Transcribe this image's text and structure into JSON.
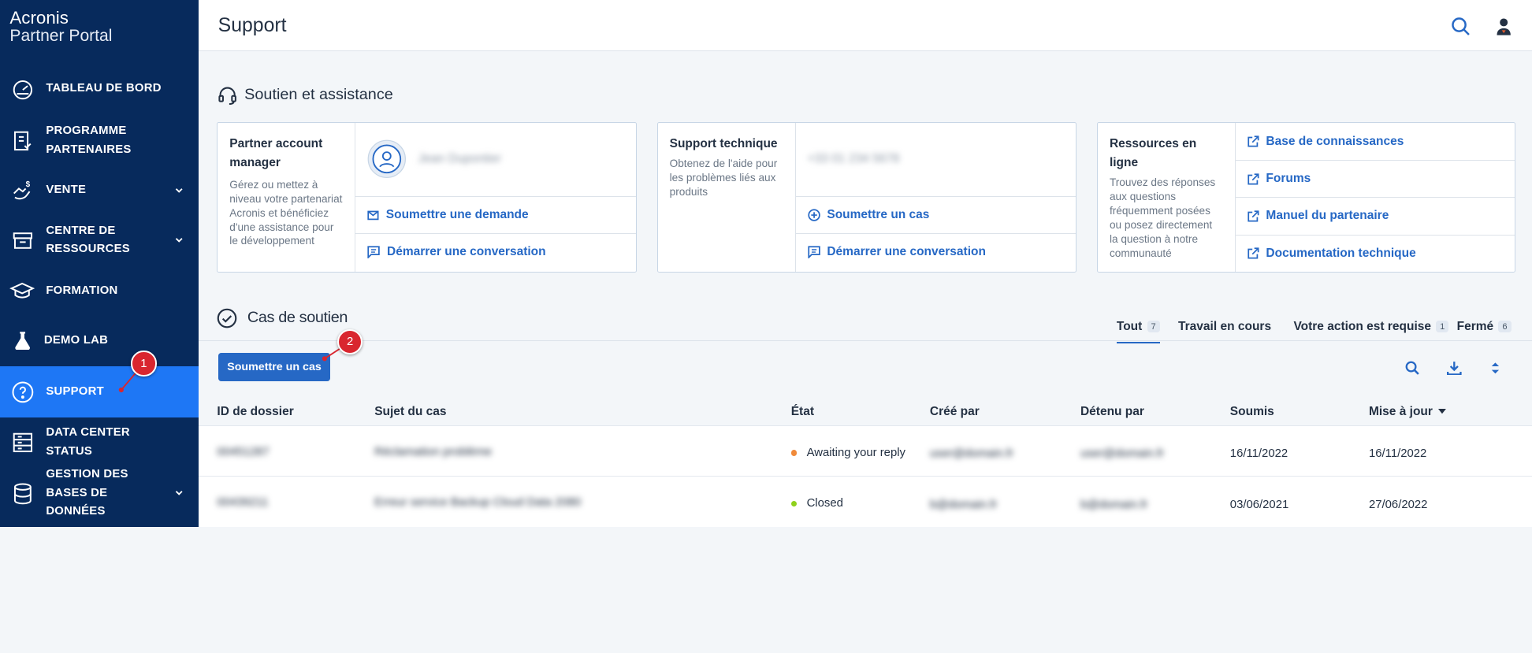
{
  "app": {
    "logo_line1": "Acronis",
    "logo_line2": "Partner Portal"
  },
  "sidebar": {
    "items": [
      {
        "label": "TABLEAU DE BORD"
      },
      {
        "label": "PROGRAMME PARTENAIRES"
      },
      {
        "label": "VENTE"
      },
      {
        "label": "CENTRE DE RESSOURCES"
      },
      {
        "label": "FORMATION"
      },
      {
        "label": "DEMO LAB"
      },
      {
        "label": "SUPPORT"
      },
      {
        "label": "DATA CENTER STATUS"
      },
      {
        "label": "GESTION DES BASES DE DONNÉES"
      }
    ]
  },
  "header": {
    "title": "Support"
  },
  "assist": {
    "heading": "Soutien et assistance",
    "card1": {
      "title": "Partner account manager",
      "desc": "Gérez ou mettez à niveau votre partenariat Acronis et bénéficiez d'une assistance pour le développement",
      "name_blurred": "Jean Dupontier",
      "link1": "Soumettre une demande",
      "link2": "Démarrer une conversation"
    },
    "card2": {
      "title": "Support technique",
      "desc": "Obtenez de l'aide pour les problèmes liés aux produits",
      "phone_blurred": "+33 01 234 5678",
      "link1": "Soumettre un cas",
      "link2": "Démarrer une conversation"
    },
    "card3": {
      "title": "Ressources en ligne",
      "desc": "Trouvez des réponses aux questions fréquemment posées ou posez directement la question à notre communauté",
      "links": [
        "Base de connaissances",
        "Forums",
        "Manuel du partenaire",
        "Documentation technique"
      ]
    }
  },
  "cases": {
    "heading": "Cas de soutien",
    "tabs": [
      {
        "label": "Tout",
        "count": "7"
      },
      {
        "label": "Travail en cours",
        "count": ""
      },
      {
        "label": "Votre action est requise",
        "count": "1"
      },
      {
        "label": "Fermé",
        "count": "6"
      }
    ],
    "submit_label": "Soumettre un cas",
    "columns": [
      "ID de dossier",
      "Sujet du cas",
      "État",
      "Créé par",
      "Détenu par",
      "Soumis",
      "Mise à jour"
    ],
    "rows": [
      {
        "id": "00451287",
        "subject": "Réclamation problème",
        "state": "Awaiting your reply",
        "created_by": "user@domain.fr",
        "owner": "user@domain.fr",
        "submitted": "16/11/2022",
        "updated": "16/11/2022"
      },
      {
        "id": "00439211",
        "subject": "Erreur service Backup Cloud Data 2080",
        "state": "Closed",
        "created_by": "b@domain.fr",
        "owner": "b@domain.fr",
        "submitted": "03/06/2021",
        "updated": "27/06/2022"
      }
    ]
  },
  "annotations": {
    "marker1": "1",
    "marker2": "2"
  },
  "colors": {
    "sidebar": "#072a5c",
    "active": "#1e77f5",
    "link": "#2668c5",
    "awaiting": "#f08a3a",
    "closed": "#8fd11c",
    "marker": "#d9262f"
  }
}
